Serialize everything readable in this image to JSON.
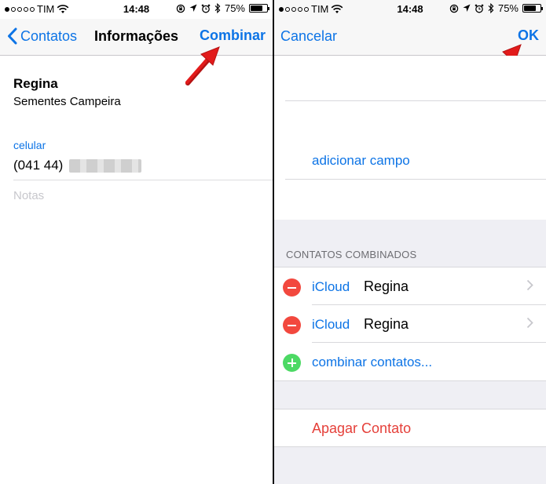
{
  "status_bar": {
    "carrier": "TIM",
    "time": "14:48",
    "battery": "75%",
    "signal_dots_filled": 1,
    "signal_dots_total": 5,
    "battery_level": 0.75
  },
  "left": {
    "nav": {
      "back_label": "Contatos",
      "title": "Informações",
      "action_label": "Combinar"
    },
    "contact": {
      "name": "Regina",
      "company": "Sementes Campeira",
      "phone_label": "celular",
      "phone_value": "(041 44)",
      "notes_placeholder": "Notas"
    }
  },
  "right": {
    "nav": {
      "cancel_label": "Cancelar",
      "ok_label": "OK"
    },
    "add_field_label": "adicionar campo",
    "linked_header": "CONTATOS COMBINADOS",
    "linked": [
      {
        "source": "iCloud",
        "name": "Regina"
      },
      {
        "source": "iCloud",
        "name": "Regina"
      }
    ],
    "link_contacts_label": "combinar contatos...",
    "delete_label": "Apagar Contato"
  },
  "colors": {
    "accent": "#0d74e6",
    "delete": "#e5403a",
    "remove": "#f2483e",
    "add": "#4cd964",
    "annotation_arrow": "#e21b1b"
  },
  "icons": {
    "back": "chevron-left-icon",
    "wifi": "wifi-icon",
    "lock_rotation": "rotation-lock-icon",
    "location": "location-arrow-icon",
    "alarm": "alarm-icon",
    "bluetooth": "bluetooth-icon",
    "battery": "battery-icon",
    "row_disclosure": "chevron-right-icon",
    "remove": "minus-circle-icon",
    "add": "plus-circle-icon"
  }
}
